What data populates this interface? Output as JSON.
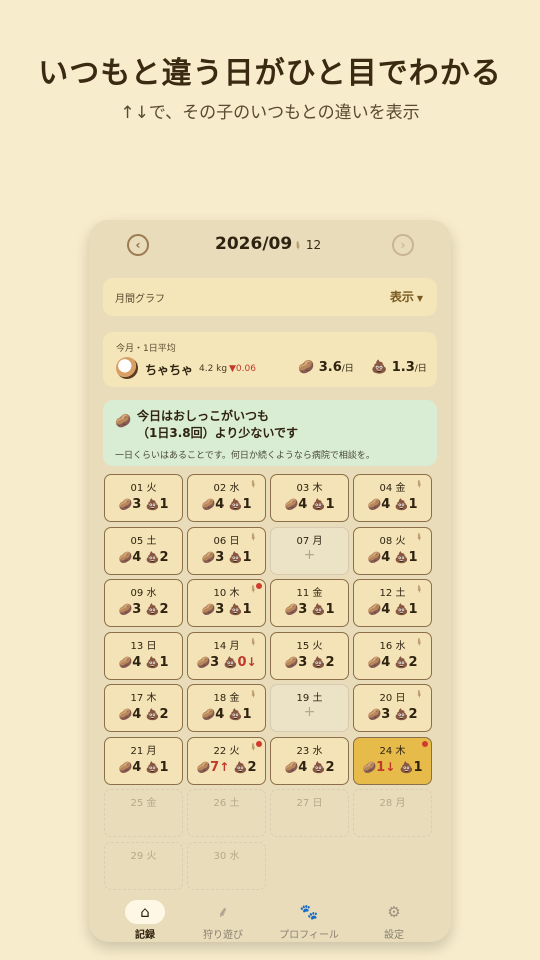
{
  "promo": {
    "headline": "いつもと違う日がひと目でわかる",
    "subline": "↑↓で、その子のいつもとの違いを表示"
  },
  "header": {
    "month": "2026/09",
    "feather_count": "12",
    "prev_icon": "prev-month-icon",
    "next_icon": "next-month-icon"
  },
  "graph": {
    "label": "月間グラフ",
    "toggle": "表示"
  },
  "average": {
    "caption": "今月・1日平均",
    "pet_name": "ちゃちゃ",
    "weight": "4.2 kg",
    "weight_delta": "▼0.06",
    "pee_avg": "3.6",
    "poo_avg": "1.3",
    "unit": "/日"
  },
  "alert": {
    "line1": "今日はおしっこがいつも",
    "line2": "（1日3.8回）より少ないです",
    "note": "一日くらいはあることです。何日か続くようなら病院で相談を。"
  },
  "days": [
    {
      "label": "01 火",
      "pee": "3",
      "poo": "1",
      "feather": false,
      "dot": false,
      "state": "normal"
    },
    {
      "label": "02 水",
      "pee": "4",
      "poo": "1",
      "feather": true,
      "dot": false,
      "state": "normal"
    },
    {
      "label": "03 木",
      "pee": "4",
      "poo": "1",
      "feather": false,
      "dot": false,
      "state": "normal"
    },
    {
      "label": "04 金",
      "pee": "4",
      "poo": "1",
      "feather": true,
      "dot": false,
      "state": "normal"
    },
    {
      "label": "05 土",
      "pee": "4",
      "poo": "2",
      "feather": false,
      "dot": false,
      "state": "normal"
    },
    {
      "label": "06 日",
      "pee": "3",
      "poo": "1",
      "feather": true,
      "dot": false,
      "state": "normal"
    },
    {
      "label": "07 月",
      "pee": "",
      "poo": "",
      "feather": false,
      "dot": false,
      "state": "empty"
    },
    {
      "label": "08 火",
      "pee": "4",
      "poo": "1",
      "feather": true,
      "dot": false,
      "state": "normal"
    },
    {
      "label": "09 水",
      "pee": "3",
      "poo": "2",
      "feather": false,
      "dot": false,
      "state": "normal"
    },
    {
      "label": "10 木",
      "pee": "3",
      "poo": "1",
      "feather": true,
      "dot": true,
      "state": "normal"
    },
    {
      "label": "11 金",
      "pee": "3",
      "poo": "1",
      "feather": false,
      "dot": false,
      "state": "normal"
    },
    {
      "label": "12 土",
      "pee": "4",
      "poo": "1",
      "feather": true,
      "dot": false,
      "state": "normal"
    },
    {
      "label": "13 日",
      "pee": "4",
      "poo": "1",
      "feather": false,
      "dot": false,
      "state": "normal"
    },
    {
      "label": "14 月",
      "pee": "3",
      "poo": "0",
      "feather": true,
      "dot": false,
      "state": "normal",
      "poo_trend": "↓"
    },
    {
      "label": "15 火",
      "pee": "3",
      "poo": "2",
      "feather": false,
      "dot": false,
      "state": "normal"
    },
    {
      "label": "16 水",
      "pee": "4",
      "poo": "2",
      "feather": true,
      "dot": false,
      "state": "normal"
    },
    {
      "label": "17 木",
      "pee": "4",
      "poo": "2",
      "feather": false,
      "dot": false,
      "state": "normal"
    },
    {
      "label": "18 金",
      "pee": "4",
      "poo": "1",
      "feather": true,
      "dot": false,
      "state": "normal"
    },
    {
      "label": "19 土",
      "pee": "",
      "poo": "",
      "feather": false,
      "dot": false,
      "state": "empty"
    },
    {
      "label": "20 日",
      "pee": "3",
      "poo": "2",
      "feather": true,
      "dot": false,
      "state": "normal"
    },
    {
      "label": "21 月",
      "pee": "4",
      "poo": "1",
      "feather": false,
      "dot": false,
      "state": "normal"
    },
    {
      "label": "22 火",
      "pee": "7",
      "poo": "2",
      "feather": true,
      "dot": true,
      "state": "normal",
      "pee_trend": "↑"
    },
    {
      "label": "23 水",
      "pee": "4",
      "poo": "2",
      "feather": false,
      "dot": false,
      "state": "normal"
    },
    {
      "label": "24 木",
      "pee": "1",
      "poo": "1",
      "feather": false,
      "dot": true,
      "state": "today",
      "pee_trend": "↓"
    },
    {
      "label": "25 金",
      "state": "future"
    },
    {
      "label": "26 土",
      "state": "future"
    },
    {
      "label": "27 日",
      "state": "future"
    },
    {
      "label": "28 月",
      "state": "future"
    },
    {
      "label": "29 火",
      "state": "future"
    },
    {
      "label": "30 水",
      "state": "future"
    }
  ],
  "tabs": [
    {
      "label": "記録",
      "icon": "home-icon",
      "active": true
    },
    {
      "label": "狩り遊び",
      "icon": "feather-icon",
      "active": false
    },
    {
      "label": "プロフィール",
      "icon": "paw-icon",
      "active": false
    },
    {
      "label": "設定",
      "icon": "gear-icon",
      "active": false
    }
  ]
}
